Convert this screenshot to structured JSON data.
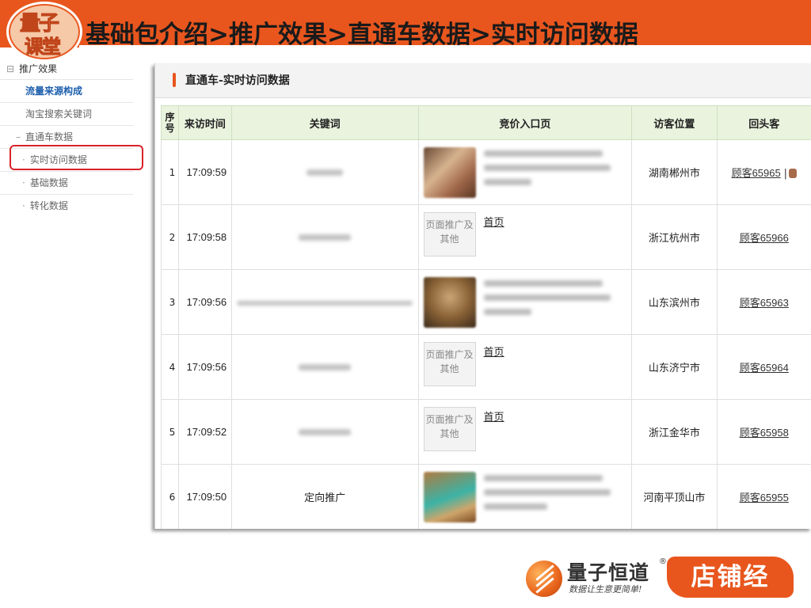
{
  "header": {
    "logo_line1": "量子",
    "logo_line2": "课堂",
    "title": "基础包介绍>推广效果>直通车数据>实时访问数据"
  },
  "sidebar": {
    "group_label": "推广效果",
    "group_prefix": "⊟",
    "items": [
      {
        "label": "流量来源构成",
        "prefix": ""
      },
      {
        "label": "淘宝搜索关键词",
        "prefix": ""
      },
      {
        "label": "直通车数据",
        "prefix": "–"
      },
      {
        "label": "实时访问数据",
        "prefix": "·"
      },
      {
        "label": "基础数据",
        "prefix": "·"
      },
      {
        "label": "转化数据",
        "prefix": "·"
      }
    ]
  },
  "panel": {
    "title": "直通车-实时访问数据",
    "columns": [
      "序号",
      "来访时间",
      "关键词",
      "竞价入口页",
      "访客位置",
      "回头客"
    ],
    "rows": [
      {
        "index": "1",
        "time": "17:09:59",
        "keyword": "",
        "entry_label": "",
        "location": "湖南郴州市",
        "visitor": "顾客65965",
        "visitor_suffix": "|"
      },
      {
        "index": "2",
        "time": "17:09:58",
        "keyword": "",
        "entry_label": "页面推广及其他",
        "entry_link": "首页",
        "location": "浙江杭州市",
        "visitor": "顾客65966",
        "visitor_suffix": ""
      },
      {
        "index": "3",
        "time": "17:09:56",
        "keyword": "",
        "entry_label": "",
        "location": "山东滨州市",
        "visitor": "顾客65963",
        "visitor_suffix": ""
      },
      {
        "index": "4",
        "time": "17:09:56",
        "keyword": "",
        "entry_label": "页面推广及其他",
        "entry_link": "首页",
        "location": "山东济宁市",
        "visitor": "顾客65964",
        "visitor_suffix": ""
      },
      {
        "index": "5",
        "time": "17:09:52",
        "keyword": "",
        "entry_label": "页面推广及其他",
        "entry_link": "首页",
        "location": "浙江金华市",
        "visitor": "顾客65958",
        "visitor_suffix": ""
      },
      {
        "index": "6",
        "time": "17:09:50",
        "keyword": "定向推广",
        "entry_label": "",
        "location": "河南平顶山市",
        "visitor": "顾客65955",
        "visitor_suffix": ""
      }
    ]
  },
  "brand": {
    "name": "量子恒道",
    "reg_mark": "®",
    "slogan": "数据让生意更简单!",
    "badge": "店铺经"
  },
  "colors": {
    "header_orange": "#e8561e",
    "active_blue": "#1d5fae",
    "highlight_red": "#d9232a",
    "table_header_green": "#e9f3de"
  }
}
